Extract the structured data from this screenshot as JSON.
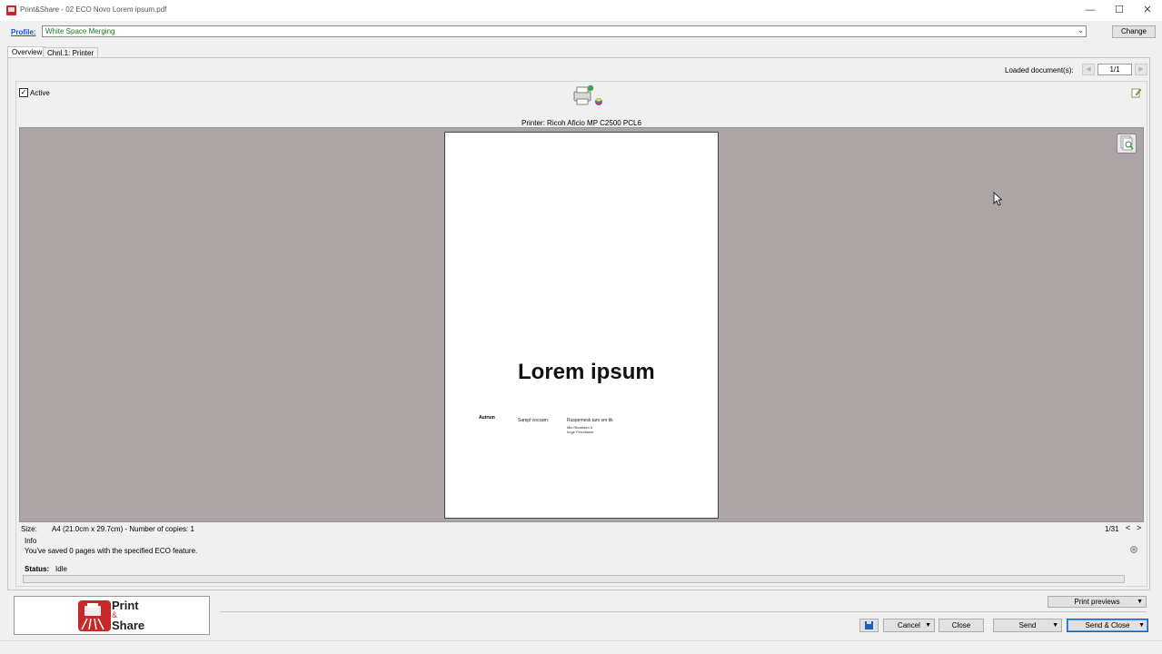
{
  "window": {
    "title": "Print&Share - 02 ECO Novo Lorem ipsum.pdf",
    "minimize": "—",
    "maximize": "☐",
    "close": "✕"
  },
  "profile": {
    "label": "Profile:",
    "value": "White Space Merging",
    "change_label": "Change"
  },
  "tabs": [
    {
      "label": "Overview",
      "active": true
    },
    {
      "label": "Chnl.1: Printer",
      "active": false
    }
  ],
  "documents": {
    "label": "Loaded document(s):",
    "counter": "1/1"
  },
  "channel": {
    "active_label": "Active",
    "active_checked": "✓",
    "printer_label": "Printer: Ricoh Aficio MP C2500 PCL6"
  },
  "preview": {
    "doc_title": "Lorem ipsum",
    "doc_author": "Autrum",
    "doc_line1": "Sampl vocsam:",
    "doc_line2": "Ruspemesk tam sm tik",
    "doc_line3a": "Mis Rkosfisen it",
    "doc_line3b": "Imge Perodlame"
  },
  "info": {
    "size_label": "Size:",
    "size_value": "A4 (21.0cm x 29.7cm) - Number of copies: 1",
    "page_count": "1/31",
    "prev": "<",
    "next": ">",
    "title": "Info",
    "message": "You've saved 0 pages with the specified ECO feature.",
    "status_label": "Status:",
    "status_value": "Idle"
  },
  "logo": {
    "print": "Print",
    "amp": "&",
    "share": "Share"
  },
  "buttons": {
    "print_previews": "Print previews",
    "cancel": "Cancel",
    "close": "Close",
    "send": "Send",
    "send_close": "Send & Close",
    "dropdown": "▼"
  },
  "colors": {
    "accent": "#1a4fd6",
    "brand": "#c62828",
    "preview_background": "#ada5a5"
  }
}
